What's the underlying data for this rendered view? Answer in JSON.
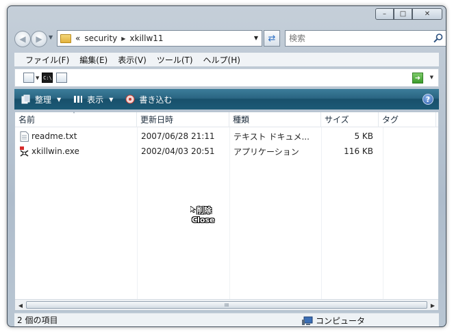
{
  "window": {
    "caption": {
      "minimize": "–",
      "maximize": "□",
      "close": "✕"
    }
  },
  "nav": {
    "back_icon": "back-arrow-icon",
    "forward_icon": "forward-arrow-icon",
    "address": {
      "overflow": "«",
      "crumbs": [
        "security",
        "xkillw11"
      ]
    },
    "search_placeholder": "検索"
  },
  "menu": [
    "ファイル(F)",
    "編集(E)",
    "表示(V)",
    "ツール(T)",
    "ヘルプ(H)"
  ],
  "commands": {
    "organize": "整理",
    "views": "表示",
    "burn": "書き込む",
    "help": "?"
  },
  "columns": {
    "name": "名前",
    "date": "更新日時",
    "type": "種類",
    "size": "サイズ",
    "tags": "タグ"
  },
  "files": [
    {
      "name": "readme.txt",
      "date": "2007/06/28 21:11",
      "type": "テキスト ドキュメ...",
      "size": "5 KB",
      "icon": "text-file-icon"
    },
    {
      "name": "xkillwin.exe",
      "date": "2002/04/03 20:51",
      "type": "アプリケーション",
      "size": "116 KB",
      "icon": "xkill-app-icon"
    }
  ],
  "cursor_overlay": {
    "line1": "削除",
    "line2": "Close"
  },
  "status": {
    "count": "2 個の項目",
    "zone": "コンピュータ"
  },
  "scrollbar": {
    "grip": "III"
  },
  "colors": {
    "command_bar": "#1c5a76",
    "selection_accent": "#2d6fc4"
  }
}
